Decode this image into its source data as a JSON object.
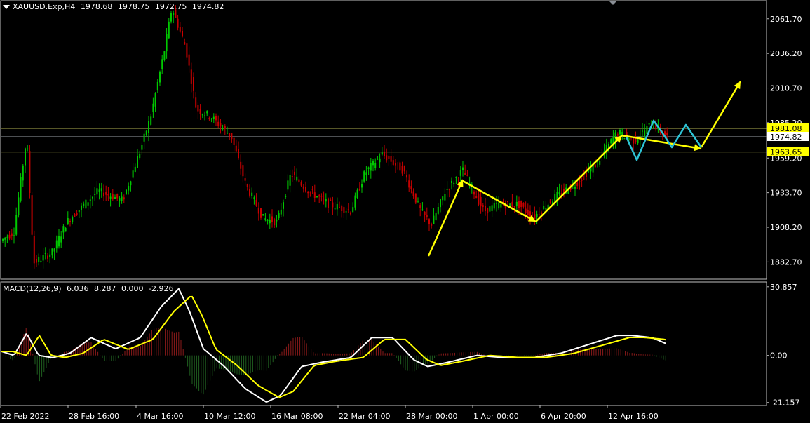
{
  "header": {
    "symbol": "XAUUSD.Exp,H4",
    "open": "1978.68",
    "high": "1978.75",
    "low": "1972.75",
    "close": "1974.82"
  },
  "macd_header": {
    "label": "MACD(12,26,9)",
    "v1": "6.036",
    "v2": "8.287",
    "v3": "0.000",
    "v4": "-2.926"
  },
  "price_axis": {
    "ticks": [
      "2061.70",
      "2036.20",
      "2010.70",
      "1985.20",
      "1959.20",
      "1933.70",
      "1908.20",
      "1882.70"
    ],
    "tick_values": [
      2061.7,
      2036.2,
      2010.7,
      1985.2,
      1959.2,
      1933.7,
      1908.2,
      1882.7
    ],
    "hlines": [
      {
        "label": "1981.08",
        "value": 1981.08,
        "color": "#e8e86a",
        "label_bg": "#ffff00",
        "label_fg": "#000"
      },
      {
        "label": "1974.82",
        "value": 1974.82,
        "color": "#9aa0a6",
        "label_bg": "#ffffff",
        "label_fg": "#000"
      },
      {
        "label": "1963.65",
        "value": 1963.65,
        "color": "#e8e86a",
        "label_bg": "#ffff00",
        "label_fg": "#000"
      }
    ]
  },
  "macd_axis": {
    "ticks": [
      "30.857",
      "0.00",
      "-21.157"
    ],
    "tick_values": [
      30.857,
      0,
      -21.157
    ]
  },
  "time_axis": {
    "labels": [
      "22 Feb 2022",
      "28 Feb 16:00",
      "4 Mar 16:00",
      "10 Mar 12:00",
      "16 Mar 08:00",
      "22 Mar 04:00",
      "28 Mar 00:00",
      "1 Apr 00:00",
      "6 Apr 20:00",
      "12 Apr 16:00"
    ]
  },
  "colors": {
    "bull": "#00c800",
    "bear": "#c80000",
    "macd_main": "#ffffff",
    "macd_signal": "#ffff00",
    "hist_pos": "#8b1a1a",
    "hist_neg": "#1f5f1f",
    "arrow_yellow": "#ffff00",
    "arrow_cyan": "#2ec4d6",
    "border": "#bfbfbf"
  },
  "chart_data": {
    "type": "candlestick",
    "key_prices": [
      {
        "x": "22 Feb 2022",
        "y": 1900
      },
      {
        "x": "28 Feb 16:00",
        "y": 1920
      },
      {
        "x": "4 Mar 16:00",
        "y": 2061
      },
      {
        "x": "10 Mar 12:00",
        "y": 1985
      },
      {
        "x": "16 Mar 08:00",
        "y": 1915
      },
      {
        "x": "22 Mar 04:00",
        "y": 1960
      },
      {
        "x": "28 Mar 00:00",
        "y": 1900
      },
      {
        "x": "1 Apr 00:00",
        "y": 1925
      },
      {
        "x": "6 Apr 20:00",
        "y": 1935
      },
      {
        "x": "12 Apr 16:00",
        "y": 1975
      }
    ],
    "last_close": 1974.82,
    "ylim": [
      1870,
      2075
    ]
  }
}
